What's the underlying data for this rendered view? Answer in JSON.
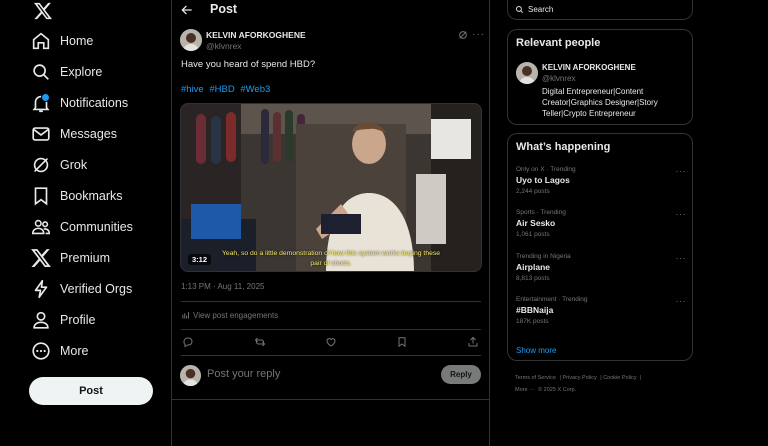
{
  "nav": {
    "items": [
      {
        "key": "home",
        "label": "Home",
        "icon": "home-icon"
      },
      {
        "key": "explore",
        "label": "Explore",
        "icon": "search-icon"
      },
      {
        "key": "notifications",
        "label": "Notifications",
        "icon": "bell-icon"
      },
      {
        "key": "messages",
        "label": "Messages",
        "icon": "envelope-icon"
      },
      {
        "key": "grok",
        "label": "Grok",
        "icon": "grok-icon"
      },
      {
        "key": "bookmarks",
        "label": "Bookmarks",
        "icon": "bookmark-icon"
      },
      {
        "key": "communities",
        "label": "Communities",
        "icon": "people-icon"
      },
      {
        "key": "premium",
        "label": "Premium",
        "icon": "x-logo-icon"
      },
      {
        "key": "verified_orgs",
        "label": "Verified Orgs",
        "icon": "lightning-icon"
      },
      {
        "key": "profile",
        "label": "Profile",
        "icon": "person-icon"
      },
      {
        "key": "more",
        "label": "More",
        "icon": "more-circle-icon"
      }
    ],
    "post_button": "Post"
  },
  "header": {
    "title": "Post"
  },
  "post": {
    "author_name": "KELVIN AFORKOGHENE",
    "author_handle": "@klvnrex",
    "text": "Have you heard of spend HBD?",
    "hashtags": [
      "#hive",
      "#HBD",
      "#Web3"
    ],
    "video": {
      "duration": "3:12",
      "caption": "Yeah, so do a little demonstration of how this system works buying these pair of shorts."
    },
    "timestamp": "1:13 PM · Aug 11, 2025",
    "engagements_label": "View post engagements"
  },
  "reply": {
    "placeholder": "Post your reply",
    "button": "Reply"
  },
  "search": {
    "placeholder": "Search"
  },
  "relevant": {
    "title": "Relevant people",
    "name": "KELVIN AFORKOGHENE",
    "handle": "@klvnrex",
    "bio": "Digital Entrepreneur|Content Creator|Graphics Designer|Story Teller|Crypto Entrepreneur"
  },
  "trending": {
    "title": "What’s happening",
    "items": [
      {
        "meta": "Only on X · Trending",
        "name": "Uyo to Lagos",
        "posts": "2,244 posts"
      },
      {
        "meta": "Sports · Trending",
        "name": "Air Sesko",
        "posts": "1,061 posts"
      },
      {
        "meta": "Trending in Nigeria",
        "name": "Airplane",
        "posts": "8,813 posts"
      },
      {
        "meta": "Entertainment · Trending",
        "name": "#BBNaija",
        "posts": "187K posts"
      }
    ],
    "show_more": "Show more"
  },
  "footer": {
    "links": [
      "Terms of Service",
      "Privacy Policy",
      "Cookie Policy"
    ],
    "more": "More ···",
    "copyright": "© 2025 X Corp."
  },
  "colors": {
    "accent": "#1d9bf0",
    "border": "#2f3336",
    "muted": "#71767b",
    "text": "#e7e9ea",
    "caption": "#f4e96b"
  }
}
